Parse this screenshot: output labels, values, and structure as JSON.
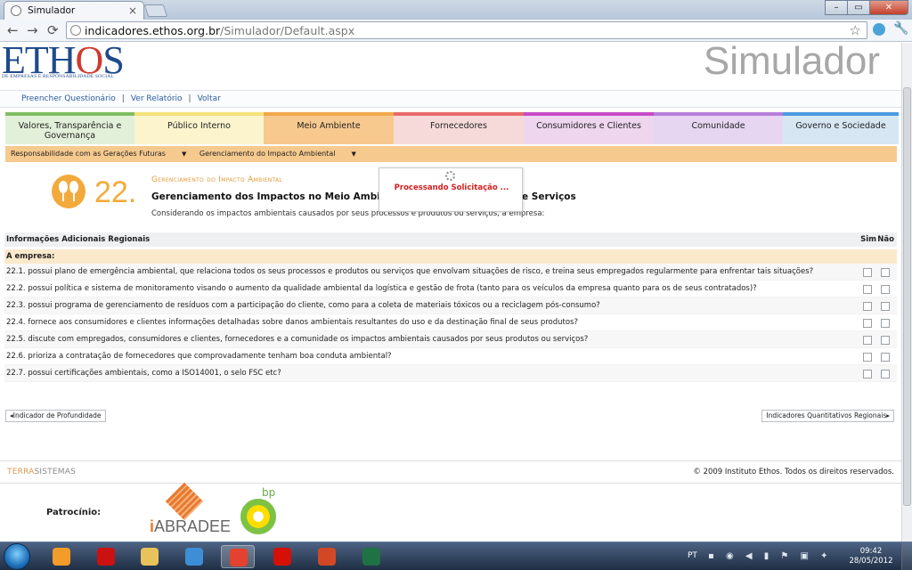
{
  "browser": {
    "tab_title": "Simulador",
    "tab_close": "×",
    "back": "←",
    "forward": "→",
    "reload": "⟳",
    "url_host": "indicadores.ethos.org.br",
    "url_path": "/Simulador/Default.aspx",
    "star": "☆",
    "wrench": "🔧",
    "minimize": "–",
    "maximize": "▭",
    "close": "✕"
  },
  "header": {
    "logo_prefix": "ETH",
    "logo_o": "O",
    "logo_suffix": "S",
    "logo_sub": "DE EMPRESAS E RESPONSABILIDADE SOCIAL",
    "title": "Simulador"
  },
  "topnav": {
    "items": [
      "Preencher Questionário",
      "Ver Relatório",
      "Voltar"
    ],
    "separator": "|"
  },
  "tabs": [
    {
      "label": "Valores, Transparência e Governança",
      "color": "#7fbf5f",
      "bg": "#e3f0d9"
    },
    {
      "label": "Público Interno",
      "color": "#f4e27a",
      "bg": "#fbf4cd"
    },
    {
      "label": "Meio Ambiente",
      "color": "#f2a84a",
      "bg": "#f7c98f"
    },
    {
      "label": "Fornecedores",
      "color": "#e96a6a",
      "bg": "#f6dada"
    },
    {
      "label": "Consumidores e Clientes",
      "color": "#c64bc6",
      "bg": "#efd6ef"
    },
    {
      "label": "Comunidade",
      "color": "#b77fdc",
      "bg": "#e7d6f2"
    },
    {
      "label": "Governo e Sociedade",
      "color": "#4b9be0",
      "bg": "#d7e6f3"
    }
  ],
  "subbar": {
    "first": "Responsabilidade com as Gerações Futuras",
    "second": "Gerenciamento do Impacto Ambiental",
    "caret": "▼"
  },
  "question": {
    "number": "22.",
    "category": "Gerenciamento do Impacto Ambiental",
    "title": "Gerenciamento dos Impactos no Meio Ambiente e",
    "title_end": "e Serviços",
    "intro": "Considerando os impactos ambientais causados por seus processos e produtos ou serviços, a empresa:"
  },
  "loader": {
    "text": "Processando Solicitação ..."
  },
  "table": {
    "header": "Informações Adicionais Regionais",
    "col_sim": "Sim",
    "col_nao": "Não",
    "section": "A empresa:",
    "rows": [
      "22.1. possui plano de emergência ambiental, que relaciona todos os seus processos e produtos ou serviços que envolvam situações de risco, e treina seus empregados regularmente para enfrentar tais situações?",
      "22.2. possui política e sistema de monitoramento visando o aumento da qualidade ambiental da logística e gestão de frota (tanto para os veículos da empresa quanto para os de seus contratados)?",
      "22.3. possui programa de gerenciamento de resíduos com a participação do cliente, como para a coleta de materiais tóxicos ou a reciclagem pós-consumo?",
      "22.4. fornece aos consumidores e clientes informações detalhadas sobre danos ambientais resultantes do uso e da destinação final de seus produtos?",
      "22.5. discute com empregados, consumidores e clientes, fornecedores e a comunidade os impactos ambientais causados por seus produtos ou serviços?",
      "22.6. prioriza a contratação de fornecedores que comprovadamente tenham boa conduta ambiental?",
      "22.7. possui certificações ambientais, como a ISO14001, o selo FSC etc?"
    ]
  },
  "buttons": {
    "prev": "◂Indicador de Profundidade",
    "next": "Indicadores Quantitativos Regionais▸"
  },
  "footer": {
    "terra_a": "TERRA",
    "terra_b": "SISTEMAS",
    "copyright": "© 2009 Instituto Ethos. Todos os direitos reservados.",
    "patrocinio": "Patrocínio:",
    "abradee_i": "i",
    "abradee": "ABRADEE",
    "bp": "bp"
  },
  "taskbar": {
    "lang": "PT",
    "time": "09:42",
    "date": "28/05/2012",
    "apps": [
      {
        "name": "media-player-icon",
        "color": "#f39c2a"
      },
      {
        "name": "opera-icon",
        "color": "#cc1111"
      },
      {
        "name": "file-explorer-icon",
        "color": "#e8c25a"
      },
      {
        "name": "internet-explorer-icon",
        "color": "#3c8fd6"
      },
      {
        "name": "chrome-icon",
        "color": "#e5412f"
      },
      {
        "name": "lastfm-icon",
        "color": "#d51007"
      },
      {
        "name": "powerpoint-icon",
        "color": "#d24726"
      },
      {
        "name": "excel-icon",
        "color": "#1f7244"
      }
    ]
  }
}
